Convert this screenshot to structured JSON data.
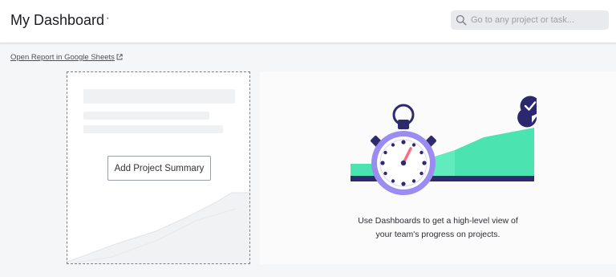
{
  "header": {
    "title": "My Dashboard",
    "more_icon": "ellipsis-icon",
    "search": {
      "placeholder": "Go to any project or task...",
      "value": "",
      "icon": "search-icon"
    }
  },
  "report_link": {
    "label": "Open Report in Google Sheets",
    "icon": "external-link-icon"
  },
  "placeholder_card": {
    "button_label": "Add Project Summary"
  },
  "info_card": {
    "line1": "Use Dashboards to get a high-level view of",
    "line2": "your team's progress on projects."
  },
  "colors": {
    "accent_green": "#4be3b0",
    "accent_purple": "#9b8cf2",
    "dark_navy": "#2e2a6e",
    "badge_navy": "#2b2870"
  }
}
